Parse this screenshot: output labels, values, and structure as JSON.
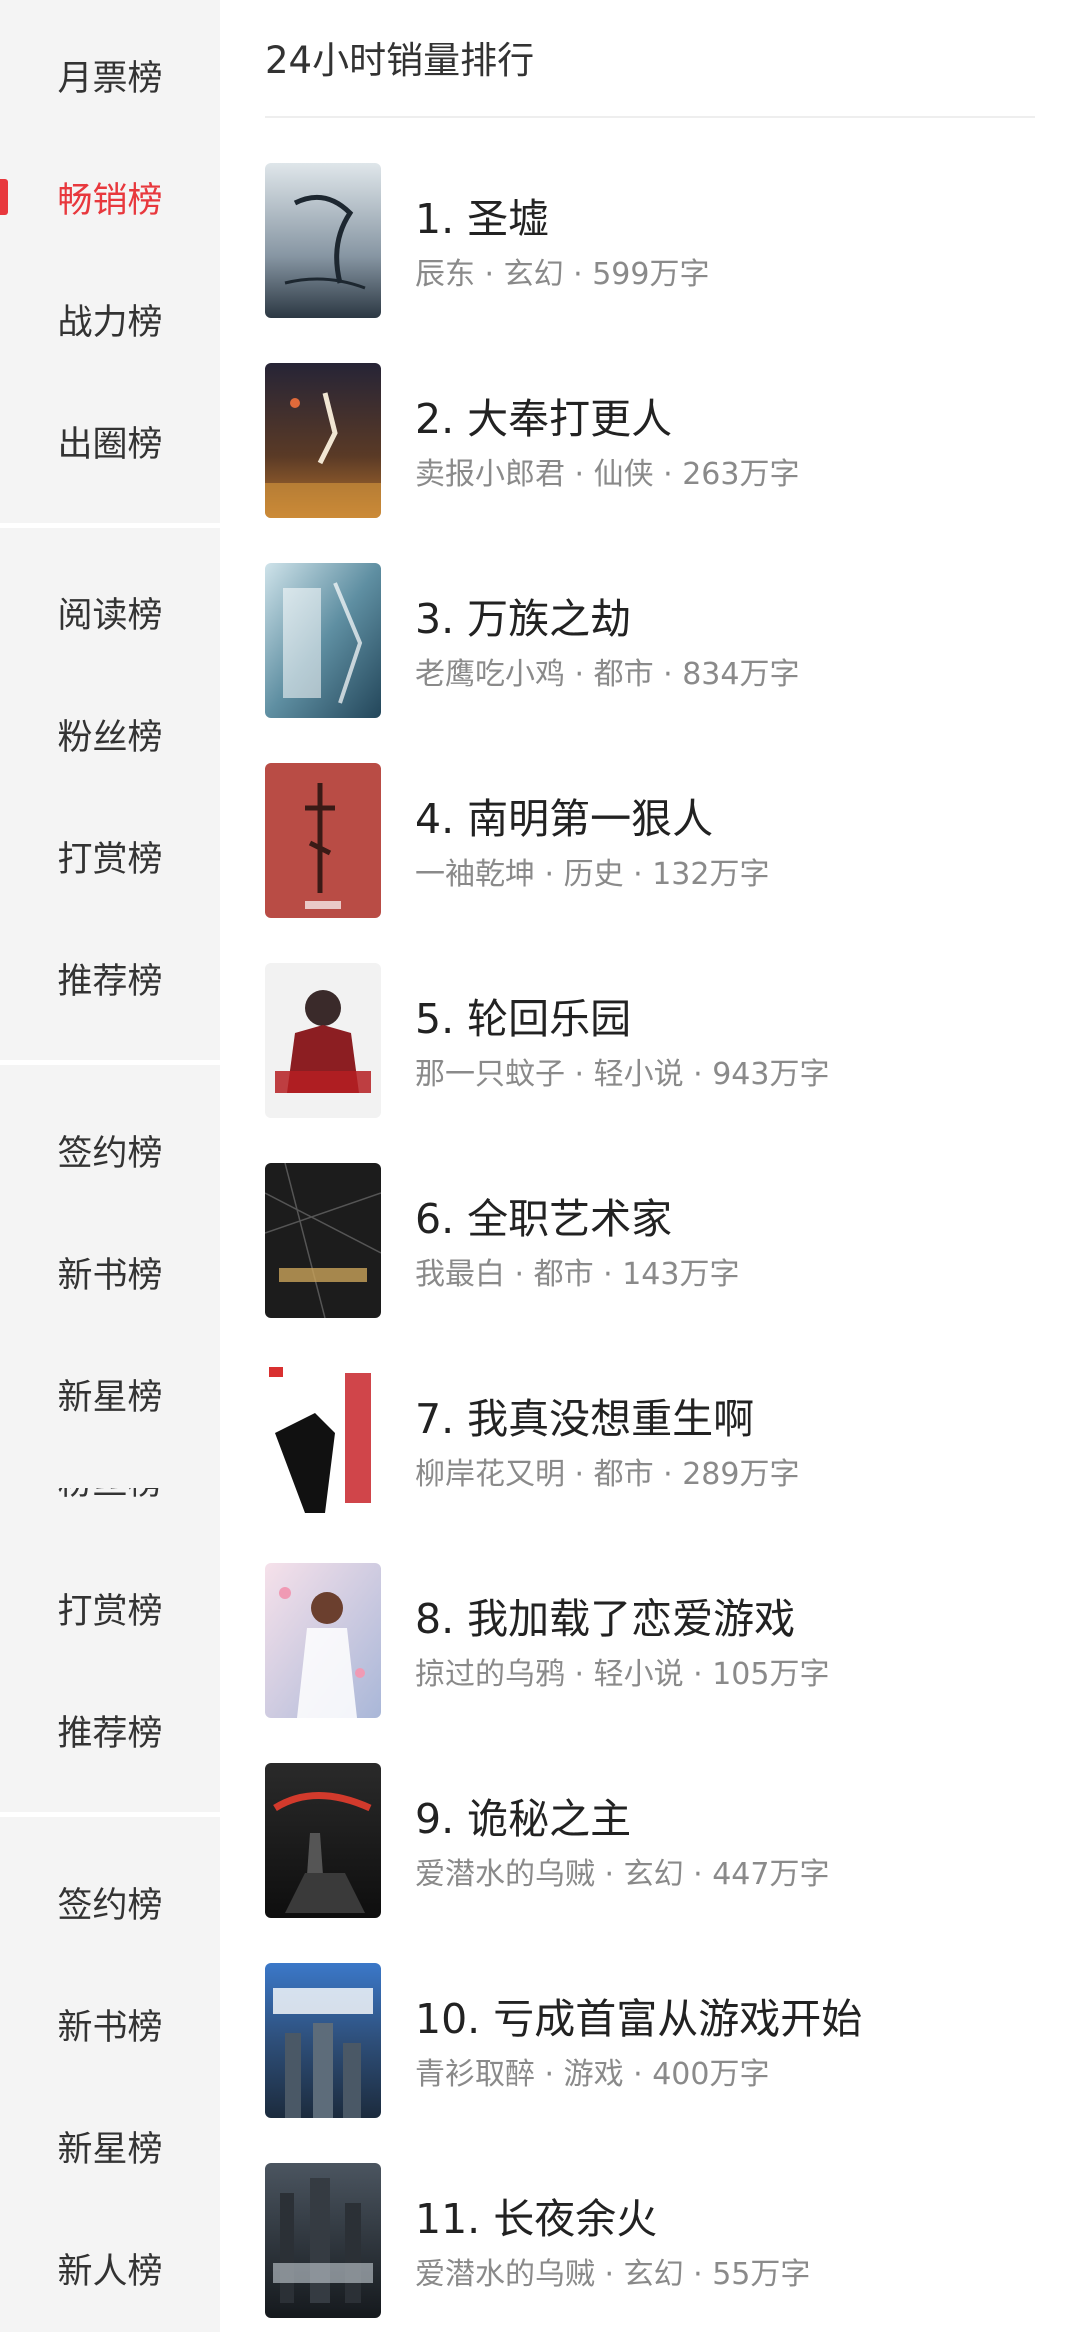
{
  "sidebar": {
    "items": [
      {
        "label": "月票榜",
        "active": false
      },
      {
        "label": "畅销榜",
        "active": true
      },
      {
        "label": "战力榜",
        "active": false
      },
      {
        "label": "出圈榜",
        "active": false
      },
      {
        "label": "阅读榜",
        "active": false
      },
      {
        "label": "粉丝榜",
        "active": false
      },
      {
        "label": "打赏榜",
        "active": false
      },
      {
        "label": "推荐榜",
        "active": false
      },
      {
        "label": "签约榜",
        "active": false
      },
      {
        "label": "新书榜",
        "active": false
      },
      {
        "label": "新星榜",
        "active": false
      },
      {
        "label": "粉丝榜",
        "active": false
      },
      {
        "label": "打赏榜",
        "active": false
      },
      {
        "label": "推荐榜",
        "active": false
      },
      {
        "label": "签约榜",
        "active": false
      },
      {
        "label": "新书榜",
        "active": false
      },
      {
        "label": "新星榜",
        "active": false
      },
      {
        "label": "新人榜",
        "active": false
      }
    ],
    "accent_color": "#e8383d"
  },
  "main": {
    "title": "24小时销量排行",
    "books": [
      {
        "title": "1. 圣墟",
        "meta": "辰东 · 玄幻 · 599万字"
      },
      {
        "title": "2. 大奉打更人",
        "meta": "卖报小郎君 · 仙侠 · 263万字"
      },
      {
        "title": "3. 万族之劫",
        "meta": "老鹰吃小鸡 · 都市 · 834万字"
      },
      {
        "title": "4. 南明第一狠人",
        "meta": "一袖乾坤 · 历史 · 132万字"
      },
      {
        "title": "5. 轮回乐园",
        "meta": "那一只蚊子 · 轻小说 · 943万字"
      },
      {
        "title": "6. 全职艺术家",
        "meta": "我最白 · 都市 · 143万字"
      },
      {
        "title": "7. 我真没想重生啊",
        "meta": "柳岸花又明 · 都市 · 289万字"
      },
      {
        "title": "8. 我加载了恋爱游戏",
        "meta": "掠过的乌鸦 · 轻小说 · 105万字"
      },
      {
        "title": "9. 诡秘之主",
        "meta": "爱潜水的乌贼 · 玄幻 · 447万字"
      },
      {
        "title": "10. 亏成首富从游戏开始",
        "meta": "青衫取醉 · 游戏 · 400万字"
      },
      {
        "title": "11. 长夜余火",
        "meta": "爱潜水的乌贼 · 玄幻 · 55万字"
      }
    ]
  }
}
